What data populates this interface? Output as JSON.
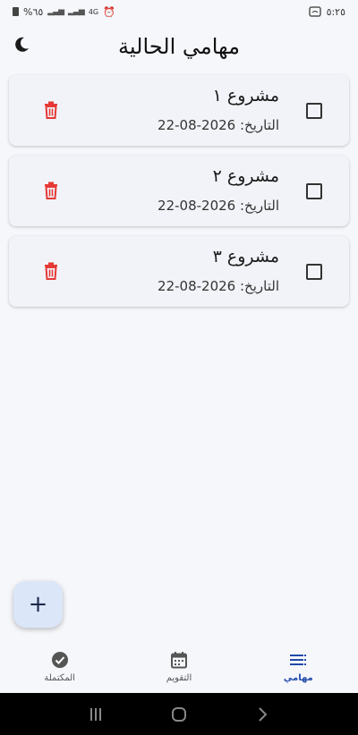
{
  "status_bar": {
    "time": "٥:٢٥",
    "battery": "%٦٥",
    "network": "4G"
  },
  "header": {
    "title": "مهامي الحالية",
    "theme_icon": "moon-icon"
  },
  "tasks": [
    {
      "title": "مشروع ١",
      "date_label": "التاريخ:",
      "date": "22-08-2026",
      "done": false
    },
    {
      "title": "مشروع ٢",
      "date_label": "التاريخ:",
      "date": "22-08-2026",
      "done": false
    },
    {
      "title": "مشروع ٣",
      "date_label": "التاريخ:",
      "date": "22-08-2026",
      "done": false
    }
  ],
  "fab": {
    "label": "+"
  },
  "bottom_nav": {
    "items": [
      {
        "label": "المكتملة",
        "icon": "check-circle-icon",
        "active": false
      },
      {
        "label": "التقويم",
        "icon": "calendar-icon",
        "active": false
      },
      {
        "label": "مهامي",
        "icon": "list-icon",
        "active": true
      }
    ]
  },
  "colors": {
    "accent": "#1f4aa8",
    "delete": "#e53935",
    "fab_bg": "#dbe6f8",
    "background": "#f6f7fb"
  }
}
